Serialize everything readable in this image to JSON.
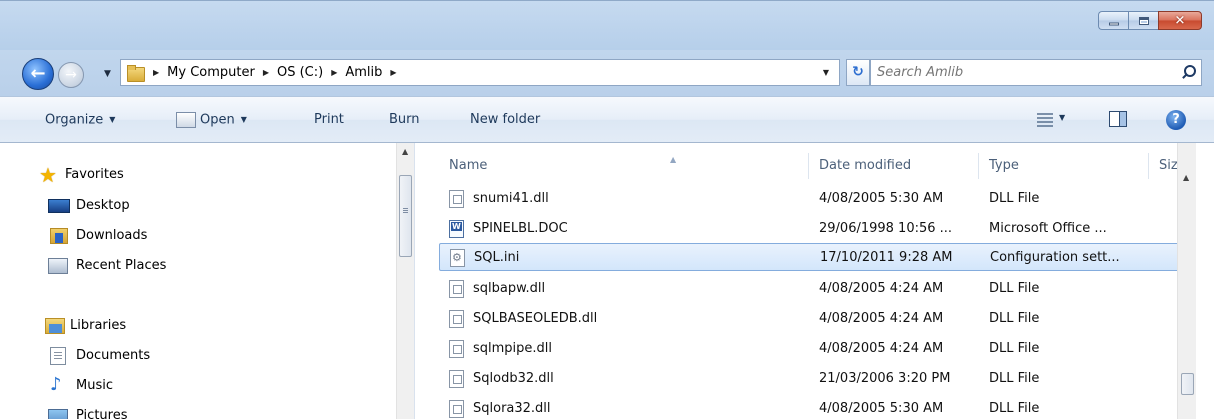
{
  "window": {
    "minimize_label": "Minimize",
    "maximize_label": "Maximize",
    "close_label": "Close"
  },
  "address": {
    "back_icon": "back-arrow-icon",
    "forward_icon": "forward-arrow-icon",
    "breadcrumb": [
      "My Computer",
      "OS (C:)",
      "Amlib"
    ],
    "search_placeholder": "Search Amlib"
  },
  "toolbar": {
    "organize": "Organize",
    "open": "Open",
    "print": "Print",
    "burn": "Burn",
    "new_folder": "New folder"
  },
  "nav": {
    "favorites": "Favorites",
    "desktop": "Desktop",
    "downloads": "Downloads",
    "recent_places": "Recent Places",
    "libraries": "Libraries",
    "documents": "Documents",
    "music": "Music",
    "pictures": "Pictures"
  },
  "columns": {
    "name": "Name",
    "date_modified": "Date modified",
    "type": "Type",
    "size": "Siz"
  },
  "files": [
    {
      "name": "snumi41.dll",
      "date": "4/08/2005 5:30 AM",
      "type": "DLL File",
      "icon": "dll-file-icon"
    },
    {
      "name": "SPINELBL.DOC",
      "date": "29/06/1998 10:56 ...",
      "type": "Microsoft Office ...",
      "icon": "word-document-icon"
    },
    {
      "name": "SQL.ini",
      "date": "17/10/2011 9:28 AM",
      "type": "Configuration sett...",
      "icon": "config-file-icon",
      "selected": true
    },
    {
      "name": "sqlbapw.dll",
      "date": "4/08/2005 4:24 AM",
      "type": "DLL File",
      "icon": "dll-file-icon"
    },
    {
      "name": "SQLBASEOLEDB.dll",
      "date": "4/08/2005 4:24 AM",
      "type": "DLL File",
      "icon": "dll-file-icon"
    },
    {
      "name": "sqlmpipe.dll",
      "date": "4/08/2005 4:24 AM",
      "type": "DLL File",
      "icon": "dll-file-icon"
    },
    {
      "name": "Sqlodb32.dll",
      "date": "21/03/2006 3:20 PM",
      "type": "DLL File",
      "icon": "dll-file-icon"
    },
    {
      "name": "Sqlora32.dll",
      "date": "4/08/2005 5:30 AM",
      "type": "DLL File",
      "icon": "dll-file-icon"
    }
  ]
}
